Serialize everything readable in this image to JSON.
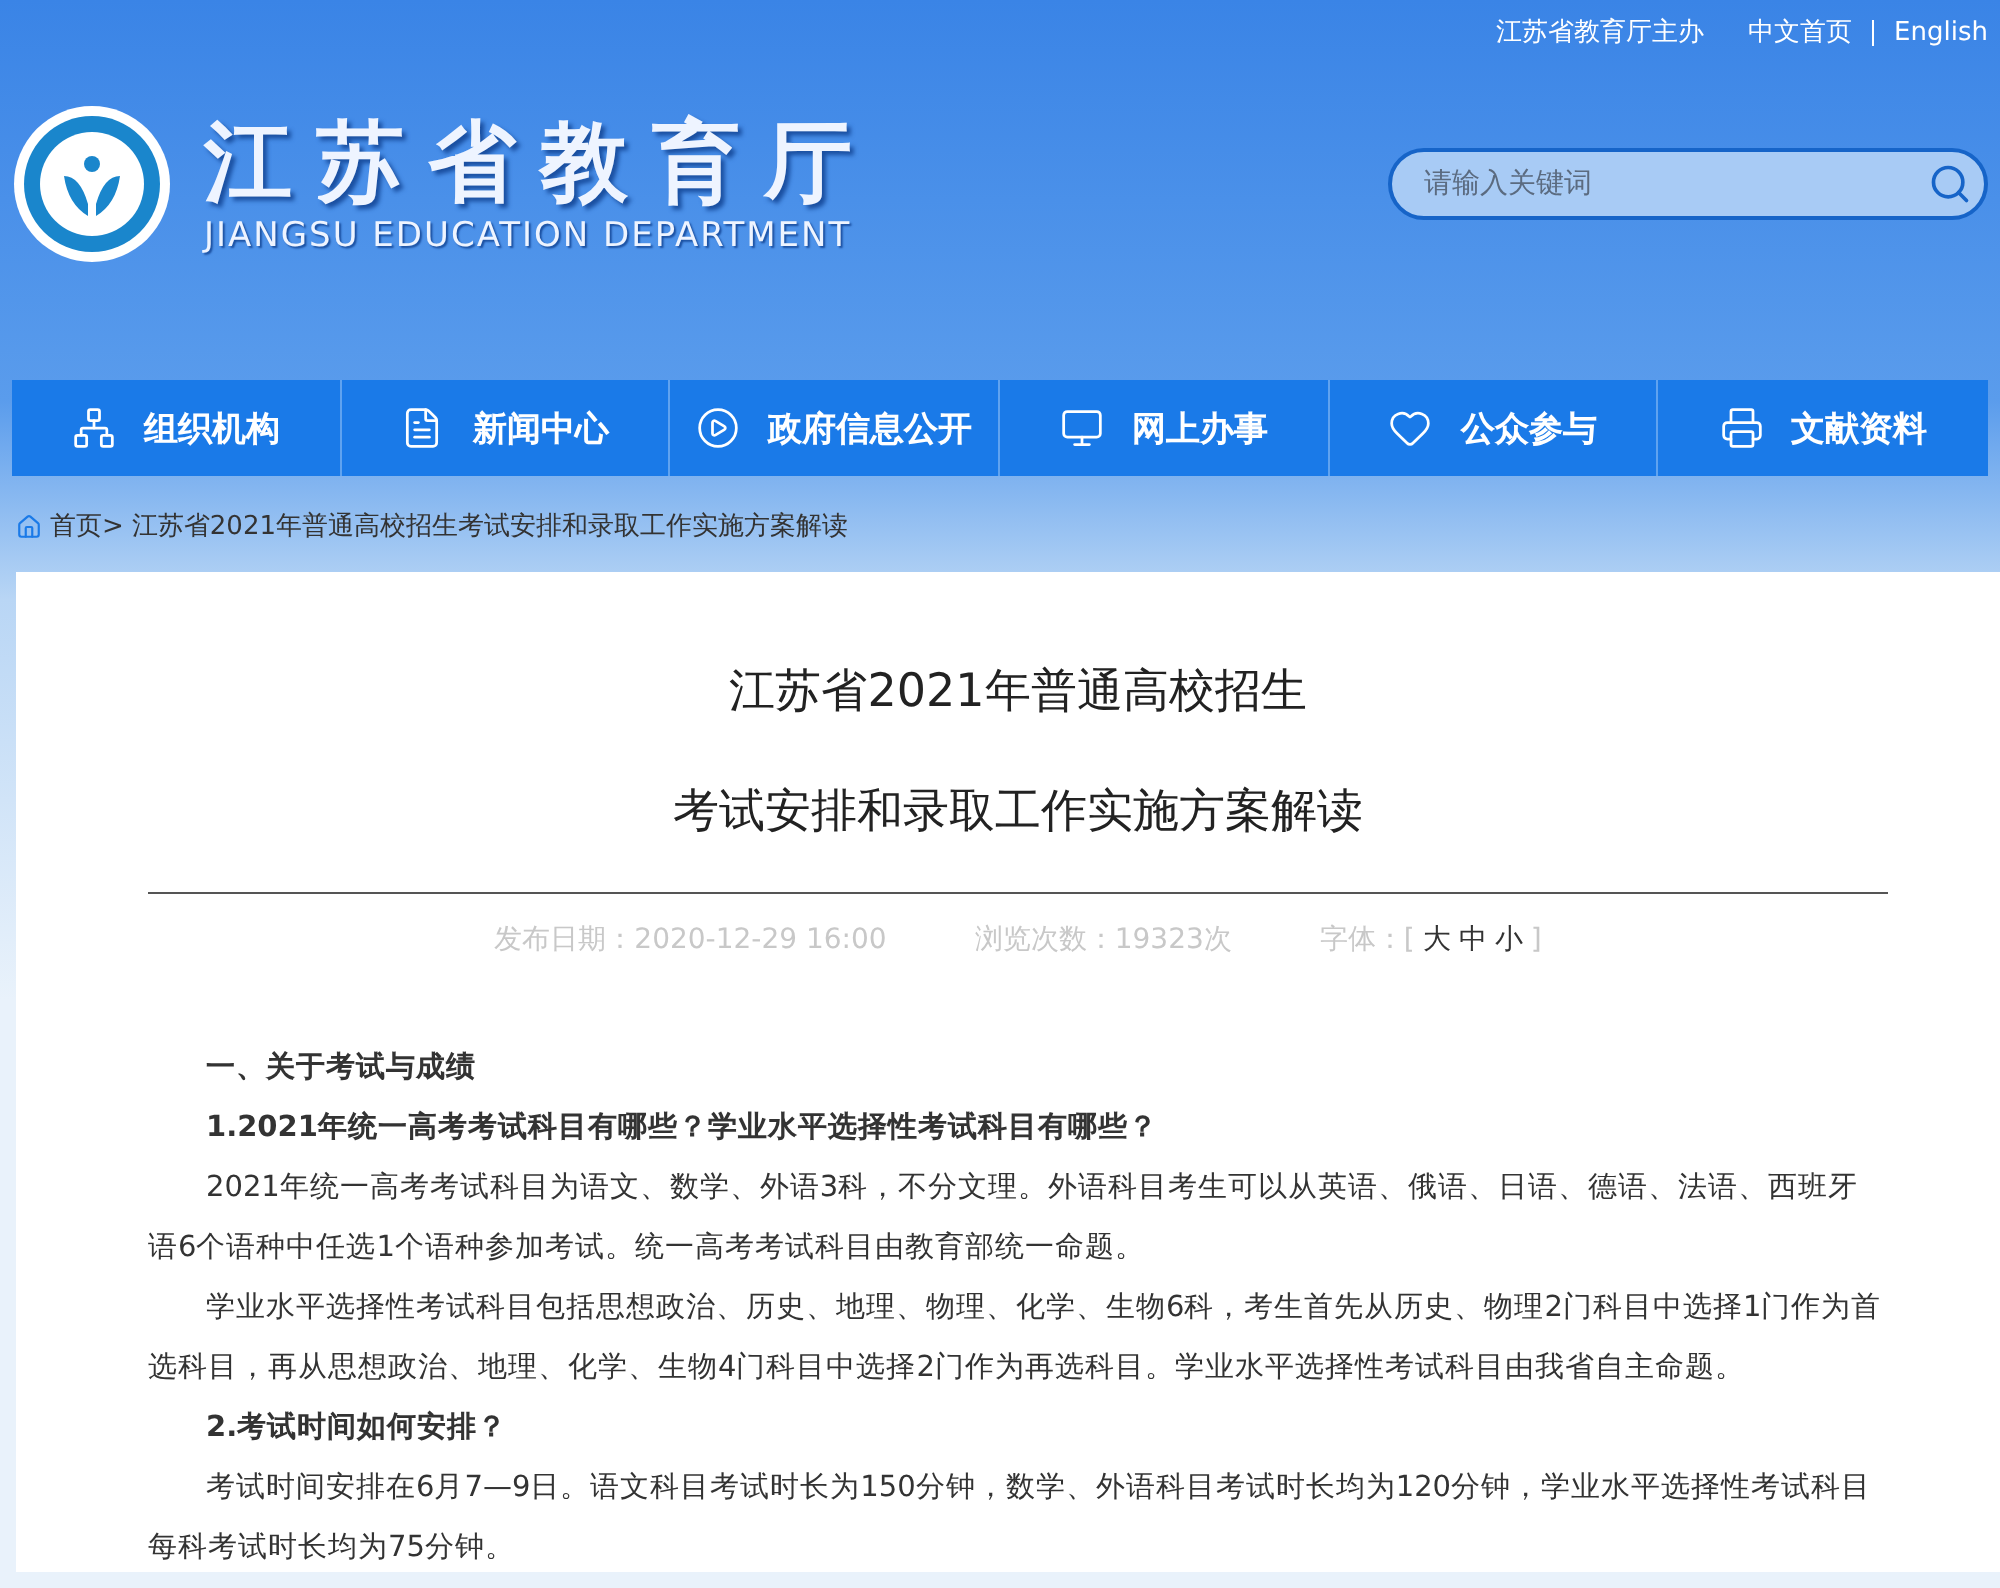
{
  "top_links": [
    {
      "label": "江苏省教育厅主办"
    },
    {
      "label": "中文首页"
    },
    {
      "label": "English"
    }
  ],
  "logo": {
    "title": "江苏省教育厅",
    "subtitle": "JIANGSU EDUCATION DEPARTMENT"
  },
  "search": {
    "placeholder": "请输入关键词"
  },
  "nav": [
    {
      "label": "组织机构"
    },
    {
      "label": "新闻中心"
    },
    {
      "label": "政府信息公开"
    },
    {
      "label": "网上办事"
    },
    {
      "label": "公众参与"
    },
    {
      "label": "文献资料"
    }
  ],
  "breadcrumb": [
    "首页>",
    "江苏省2021年普通高校招生考试安排和录取工作实施方案解读"
  ],
  "article": {
    "title_lines": [
      "江苏省2021年普通高校招生",
      "考试安排和录取工作实施方案解读"
    ],
    "date": "发布日期：2020-12-29 16:00",
    "views": "浏览次数：19323次",
    "font_label": "字体：[",
    "font_sizes": [
      {
        "label": "大"
      },
      {
        "label": "中"
      },
      {
        "label": "小"
      }
    ],
    "font_close": "]",
    "body": [
      {
        "kind": "heading",
        "text": "一、关于考试与成绩"
      },
      {
        "kind": "question",
        "text": "1.2021年统一高考考试科目有哪些？学业水平选择性考试科目有哪些？"
      },
      {
        "kind": "paragraph",
        "text": "2021年统一高考考试科目为语文、数学、外语3科，不分文理。外语科目考生可以从英语、俄语、日语、德语、法语、西班牙语6个语种中任选1个语种参加考试。统一高考考试科目由教育部统一命题。"
      },
      {
        "kind": "paragraph",
        "text": "学业水平选择性考试科目包括思想政治、历史、地理、物理、化学、生物6科，考生首先从历史、物理2门科目中选择1门作为首选科目，再从思想政治、地理、化学、生物4门科目中选择2门作为再选科目。学业水平选择性考试科目由我省自主命题。"
      },
      {
        "kind": "question",
        "text": "2.考试时间如何安排？"
      },
      {
        "kind": "paragraph",
        "text": "考试时间安排在6月7—9日。语文科目考试时长为150分钟，数学、外语科目考试时长均为120分钟，学业水平选择性考试科目每科考试时长均为75分钟。"
      }
    ]
  }
}
